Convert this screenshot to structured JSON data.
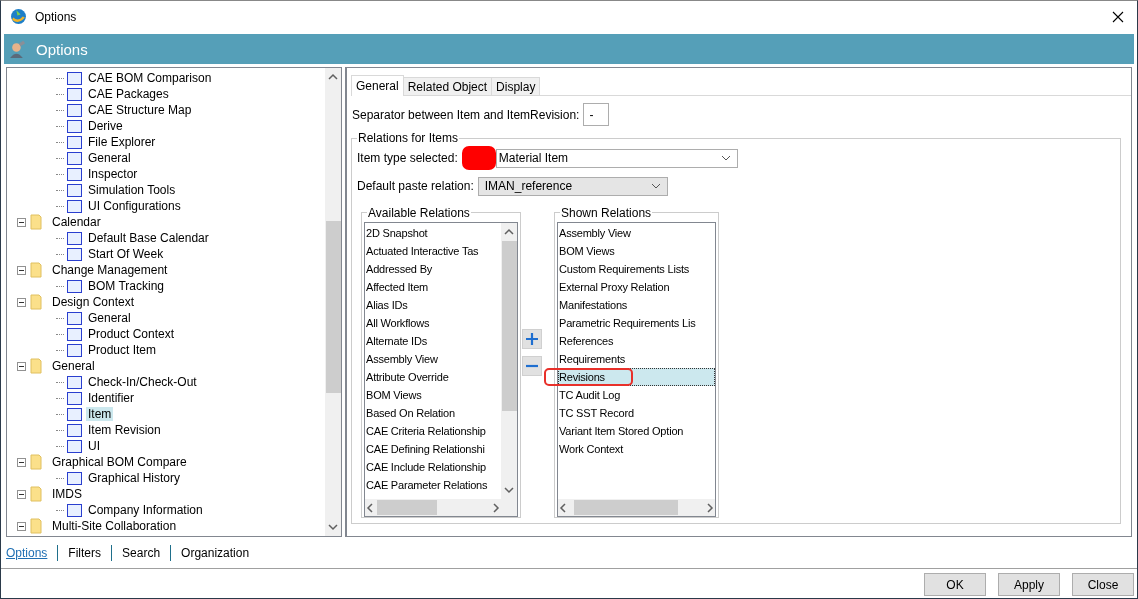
{
  "window": {
    "title": "Options"
  },
  "header": {
    "title": "Options"
  },
  "tree": {
    "items": [
      {
        "children": [
          {
            "kind": "page",
            "label": "CAE BOM Comparison",
            "selected": false
          },
          {
            "kind": "page",
            "label": "CAE Packages",
            "selected": false
          },
          {
            "kind": "page",
            "label": "CAE Structure Map",
            "selected": false
          },
          {
            "kind": "page",
            "label": "Derive",
            "selected": false
          },
          {
            "kind": "page",
            "label": "File Explorer",
            "selected": false
          },
          {
            "kind": "page",
            "label": "General",
            "selected": false
          },
          {
            "kind": "page",
            "label": "Inspector",
            "selected": false
          },
          {
            "kind": "page",
            "label": "Simulation Tools",
            "selected": false
          },
          {
            "kind": "page",
            "label": "UI Configurations",
            "selected": false
          }
        ]
      },
      {
        "kind": "folder",
        "label": "Calendar",
        "expanded": true,
        "selected": false,
        "children": [
          {
            "kind": "page",
            "label": "Default Base Calendar",
            "selected": false
          },
          {
            "kind": "page",
            "label": "Start Of Week",
            "selected": false
          }
        ]
      },
      {
        "kind": "folder",
        "label": "Change Management",
        "expanded": true,
        "selected": false,
        "children": [
          {
            "kind": "page",
            "label": "BOM Tracking",
            "selected": false
          }
        ]
      },
      {
        "kind": "folder",
        "label": "Design Context",
        "expanded": true,
        "selected": false,
        "children": [
          {
            "kind": "page",
            "label": "General",
            "selected": false
          },
          {
            "kind": "page",
            "label": "Product Context",
            "selected": false
          },
          {
            "kind": "page",
            "label": "Product Item",
            "selected": false
          }
        ]
      },
      {
        "kind": "folder",
        "label": "General",
        "expanded": true,
        "selected": false,
        "children": [
          {
            "kind": "page",
            "label": "Check-In/Check-Out",
            "selected": false
          },
          {
            "kind": "page",
            "label": "Identifier",
            "selected": false
          },
          {
            "kind": "page",
            "label": "Item",
            "selected": true
          },
          {
            "kind": "page",
            "label": "Item Revision",
            "selected": false
          },
          {
            "kind": "page",
            "label": "UI",
            "selected": false
          }
        ]
      },
      {
        "kind": "folder",
        "label": "Graphical BOM Compare",
        "expanded": true,
        "selected": false,
        "children": [
          {
            "kind": "page",
            "label": "Graphical History",
            "selected": false
          }
        ]
      },
      {
        "kind": "folder",
        "label": "IMDS",
        "expanded": true,
        "selected": false,
        "children": [
          {
            "kind": "page",
            "label": "Company Information",
            "selected": false
          }
        ]
      },
      {
        "kind": "folder",
        "label": "Multi-Site Collaboration",
        "expanded": true,
        "selected": false
      }
    ]
  },
  "tabs": [
    {
      "label": "General",
      "selected": true
    },
    {
      "label": "Related Object",
      "selected": false
    },
    {
      "label": "Display",
      "selected": false
    }
  ],
  "separator": {
    "label": "Separator between Item and ItemRevision:",
    "value": "-"
  },
  "relations": {
    "title": "Relations for Items",
    "item_type": {
      "label": "Item type selected:",
      "value": "Material Item",
      "redacted": true
    },
    "paste_relation": {
      "label": "Default paste relation:",
      "value": "IMAN_reference"
    },
    "available": {
      "title": "Available Relations",
      "items": [
        {
          "label": "2D Snapshot",
          "selected": false
        },
        {
          "label": "Actuated Interactive Tas",
          "selected": false
        },
        {
          "label": "Addressed By",
          "selected": false
        },
        {
          "label": "Affected Item",
          "selected": false
        },
        {
          "label": "Alias IDs",
          "selected": false
        },
        {
          "label": "All Workflows",
          "selected": false
        },
        {
          "label": "Alternate IDs",
          "selected": false
        },
        {
          "label": "Assembly View",
          "selected": false
        },
        {
          "label": "Attribute Override",
          "selected": false
        },
        {
          "label": "BOM Views",
          "selected": false
        },
        {
          "label": "Based On Relation",
          "selected": false
        },
        {
          "label": "CAE Criteria Relationship",
          "selected": false
        },
        {
          "label": "CAE Defining Relationshi",
          "selected": false
        },
        {
          "label": "CAE Include Relationship",
          "selected": false
        },
        {
          "label": "CAE Parameter Relations",
          "selected": false
        }
      ]
    },
    "move_buttons": [
      {
        "kind": "add"
      },
      {
        "kind": "remove"
      }
    ],
    "shown": {
      "title": "Shown Relations",
      "items": [
        {
          "label": "Assembly View",
          "selected": false,
          "highlighted": false
        },
        {
          "label": "BOM Views",
          "selected": false,
          "highlighted": false
        },
        {
          "label": "Custom Requirements Lists",
          "selected": false,
          "highlighted": false
        },
        {
          "label": "External Proxy Relation",
          "selected": false,
          "highlighted": false
        },
        {
          "label": "Manifestations",
          "selected": false,
          "highlighted": false
        },
        {
          "label": "Parametric Requirements Lis",
          "selected": false,
          "highlighted": false
        },
        {
          "label": "References",
          "selected": false,
          "highlighted": false
        },
        {
          "label": "Requirements",
          "selected": false,
          "highlighted": false
        },
        {
          "label": "Revisions",
          "selected": true,
          "highlighted": true
        },
        {
          "label": "TC Audit Log",
          "selected": false,
          "highlighted": false
        },
        {
          "label": "TC SST Record",
          "selected": false,
          "highlighted": false
        },
        {
          "label": "Variant Item Stored Option",
          "selected": false,
          "highlighted": false
        },
        {
          "label": "Work Context",
          "selected": false,
          "highlighted": false
        }
      ]
    }
  },
  "nav_links": [
    {
      "label": "Options",
      "selected": true
    },
    {
      "label": "Filters",
      "selected": false
    },
    {
      "label": "Search",
      "selected": false
    },
    {
      "label": "Organization",
      "selected": false
    }
  ],
  "buttons": [
    {
      "label": "OK"
    },
    {
      "label": "Apply"
    },
    {
      "label": "Close"
    }
  ]
}
